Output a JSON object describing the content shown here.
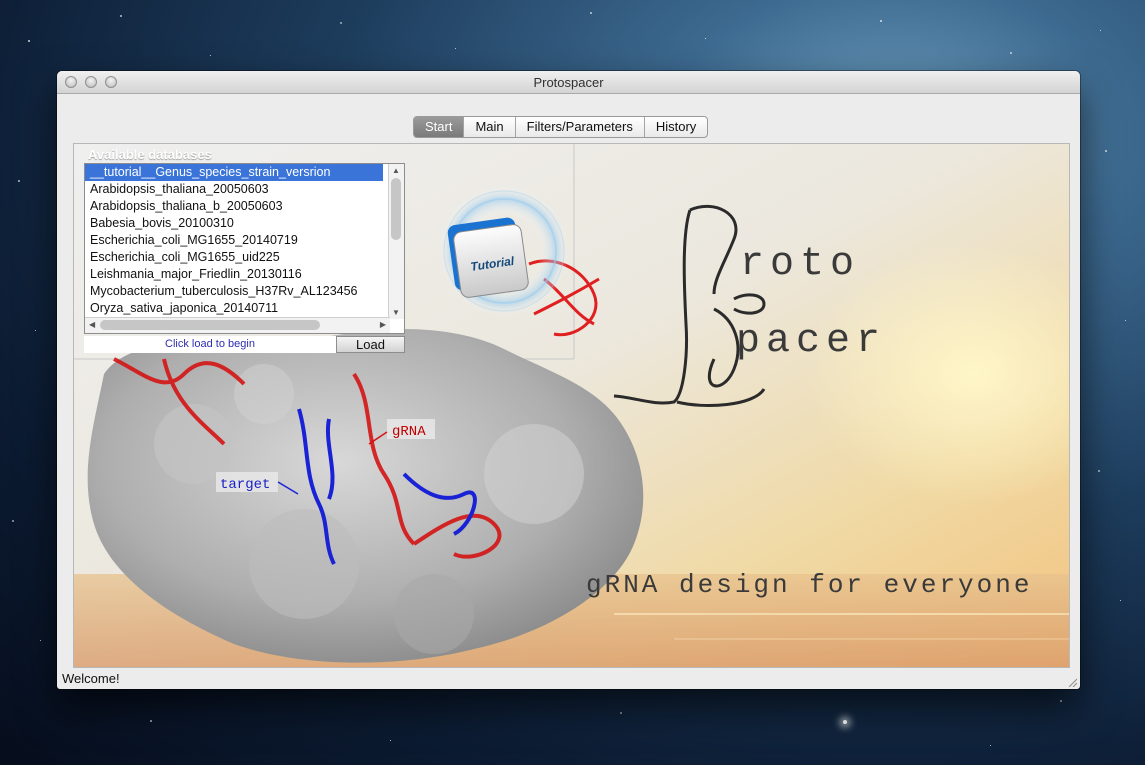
{
  "window": {
    "title": "Protospacer"
  },
  "tabs": [
    {
      "label": "Start",
      "active": true
    },
    {
      "label": "Main",
      "active": false
    },
    {
      "label": "Filters/Parameters",
      "active": false
    },
    {
      "label": "History",
      "active": false
    }
  ],
  "databases": {
    "header": "Available databases",
    "items": [
      "__tutorial__Genus_species_strain_versrion",
      "Arabidopsis_thaliana_20050603",
      "Arabidopsis_thaliana_b_20050603",
      "Babesia_bovis_20100310",
      "Escherichia_coli_MG1655_20140719",
      "Escherichia_coli_MG1655_uid225",
      "Leishmania_major_Friedlin_20130116",
      "Mycobacterium_tuberculosis_H37Rv_AL123456",
      "Oryza_sativa_japonica_20140711"
    ],
    "selected": "__tutorial__Genus_species_strain_versrion",
    "hint": "Click load to begin",
    "load_label": "Load"
  },
  "splash": {
    "tutorial_label": "Tutorial",
    "logo_top": "roto",
    "logo_bottom": "pacer",
    "tagline": "gRNA design for everyone",
    "label_grna": "gRNA",
    "label_target": "target"
  },
  "status": {
    "text": "Welcome!"
  }
}
